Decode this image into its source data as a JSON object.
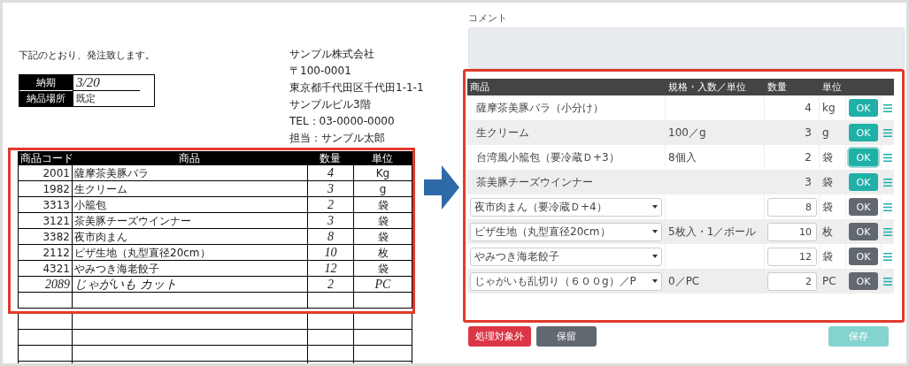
{
  "order_sheet": {
    "intro": "下記のとおり、発注致します。",
    "delivery": [
      {
        "label": "納期",
        "value": "3/20",
        "handwritten": true
      },
      {
        "label": "納品場所",
        "value": "既定",
        "handwritten": false
      }
    ],
    "sender": [
      "サンプル株式会社",
      "〒100-0001",
      "東京都千代田区千代田1-1-1",
      "サンプルビル3階",
      "TEL：03-0000-0000",
      "担当：サンプル太郎"
    ],
    "columns": [
      "商品コード",
      "商品",
      "数量",
      "単位"
    ],
    "rows": [
      {
        "code": "2001",
        "product": "薩摩茶美豚バラ",
        "quantity": "4",
        "unit": "Kg",
        "handwritten": false
      },
      {
        "code": "1982",
        "product": "生クリーム",
        "quantity": "3",
        "unit": "g",
        "handwritten": false
      },
      {
        "code": "3313",
        "product": "小籠包",
        "quantity": "2",
        "unit": "袋",
        "handwritten": false
      },
      {
        "code": "3121",
        "product": "茶美豚チーズウインナー",
        "quantity": "3",
        "unit": "袋",
        "handwritten": false
      },
      {
        "code": "3382",
        "product": "夜市肉まん",
        "quantity": "8",
        "unit": "袋",
        "handwritten": false
      },
      {
        "code": "2112",
        "product": "ピザ生地（丸型直径20cm）",
        "quantity": "10",
        "unit": "枚",
        "handwritten": false
      },
      {
        "code": "4321",
        "product": "やみつき海老餃子",
        "quantity": "12",
        "unit": "袋",
        "handwritten": false
      },
      {
        "code": "2089",
        "product": "じゃがいも カット",
        "quantity": "2",
        "unit": "PC",
        "handwritten": true
      }
    ]
  },
  "entry_form": {
    "comment": {
      "label": "コメント"
    },
    "columns": [
      "商品",
      "規格・入数／単位",
      "数量",
      "単位"
    ],
    "rows": [
      {
        "kind": "text",
        "product": "薩摩茶美豚バラ（小分け）",
        "quantity": "4",
        "unit": "kg",
        "ok_label": "OK",
        "confirmed": true,
        "focused": false
      },
      {
        "kind": "text",
        "product": "生クリーム",
        "spec": "100／g",
        "quantity": "3",
        "unit": "g",
        "ok_label": "OK",
        "confirmed": true,
        "focused": false
      },
      {
        "kind": "text",
        "product": "台湾風小籠包（要冷蔵Ｄ+3）",
        "spec": "8個入",
        "quantity": "2",
        "unit": "袋",
        "ok_label": "OK",
        "confirmed": true,
        "focused": true
      },
      {
        "kind": "text",
        "product": "茶美豚チーズウインナー",
        "quantity": "3",
        "unit": "袋",
        "ok_label": "OK",
        "confirmed": true,
        "focused": false
      },
      {
        "kind": "select",
        "product": "夜市肉まん（要冷蔵Ｄ+4）",
        "quantity": "8",
        "unit": "袋",
        "ok_label": "OK",
        "confirmed": false,
        "focused": false
      },
      {
        "kind": "select",
        "product": "ピザ生地（丸型直径20cm）",
        "spec": "5枚入・1／ボール",
        "quantity": "10",
        "unit": "枚",
        "ok_label": "OK",
        "confirmed": false,
        "focused": false
      },
      {
        "kind": "select",
        "product": "やみつき海老餃子",
        "quantity": "12",
        "unit": "袋",
        "ok_label": "OK",
        "confirmed": false,
        "focused": false
      },
      {
        "kind": "select",
        "product": "じゃがいも乱切り（６００g）／P",
        "spec": "0／PC",
        "quantity": "2",
        "unit": "PC",
        "ok_label": "OK",
        "confirmed": false,
        "focused": false
      }
    ],
    "buttons": [
      {
        "label": "処理対象外",
        "kind": "danger",
        "disabled": false
      },
      {
        "label": "保留",
        "kind": "secondary",
        "disabled": false
      },
      {
        "label": "保存",
        "kind": "primary",
        "disabled": true
      }
    ]
  }
}
